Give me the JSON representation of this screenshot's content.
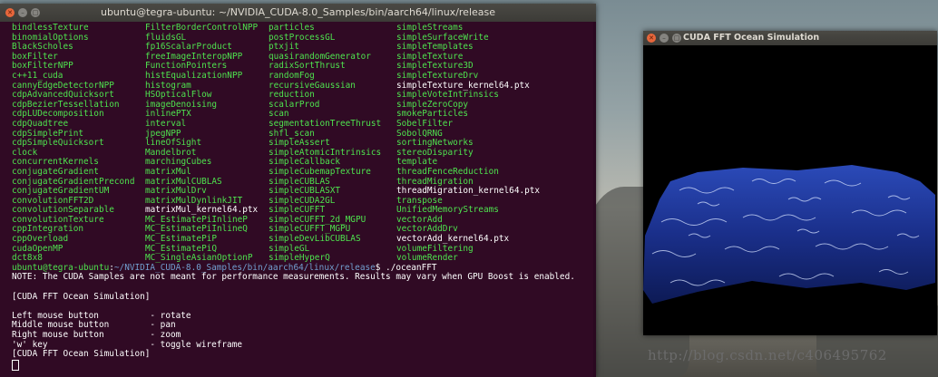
{
  "terminal": {
    "title": "ubuntu@tegra-ubuntu: ~/NVIDIA_CUDA-8.0_Samples/bin/aarch64/linux/release",
    "listing": [
      "bindlessTexture",
      "FilterBorderControlNPP",
      "particles",
      "simpleStreams",
      "binomialOptions",
      "fluidsGL",
      "postProcessGL",
      "simpleSurfaceWrite",
      "BlackScholes",
      "fp16ScalarProduct",
      "ptxjit",
      "simpleTemplates",
      "boxFilter",
      "freeImageInteropNPP",
      "quasirandomGenerator",
      "simpleTexture",
      "boxFilterNPP",
      "FunctionPointers",
      "radixSortThrust",
      "simpleTexture3D",
      "c++11_cuda",
      "histEqualizationNPP",
      "randomFog",
      "simpleTextureDrv",
      "cannyEdgeDetectorNPP",
      "histogram",
      "recursiveGaussian",
      "simpleTexture_kernel64.ptx",
      "cdpAdvancedQuicksort",
      "HSOpticalFlow",
      "reduction",
      "simpleVoteIntrinsics",
      "cdpBezierTessellation",
      "imageDenoising",
      "scalarProd",
      "simpleZeroCopy",
      "cdpLUDecomposition",
      "inlinePTX",
      "scan",
      "smokeParticles",
      "cdpQuadtree",
      "interval",
      "segmentationTreeThrust",
      "SobelFilter",
      "cdpSimplePrint",
      "jpegNPP",
      "shfl_scan",
      "SobolQRNG",
      "cdpSimpleQuicksort",
      "lineOfSight",
      "simpleAssert",
      "sortingNetworks",
      "clock",
      "Mandelbrot",
      "simpleAtomicIntrinsics",
      "stereoDisparity",
      "concurrentKernels",
      "marchingCubes",
      "simpleCallback",
      "template",
      "conjugateGradient",
      "matrixMul",
      "simpleCubemapTexture",
      "threadFenceReduction",
      "conjugateGradientPrecond",
      "matrixMulCUBLAS",
      "simpleCUBLAS",
      "threadMigration",
      "conjugateGradientUM",
      "matrixMulDrv",
      "simpleCUBLASXT",
      "threadMigration_kernel64.ptx",
      "convolutionFFT2D",
      "matrixMulDynlinkJIT",
      "simpleCUDA2GL",
      "transpose",
      "convolutionSeparable",
      "matrixMul_kernel64.ptx",
      "simpleCUFFT",
      "UnifiedMemoryStreams",
      "convolutionTexture",
      "MC_EstimatePiInlineP",
      "simpleCUFFT_2d_MGPU",
      "vectorAdd",
      "cppIntegration",
      "MC_EstimatePiInlineQ",
      "simpleCUFFT_MGPU",
      "vectorAddDrv",
      "cppOverload",
      "MC_EstimatePiP",
      "simpleDevLibCUBLAS",
      "vectorAdd_kernel64.ptx",
      "cudaOpenMP",
      "MC_EstimatePiQ",
      "simpleGL",
      "volumeFiltering",
      "dct8x8",
      "MC_SingleAsianOptionP",
      "simpleHyperQ",
      "volumeRender"
    ],
    "listing_white": [
      "simpleTexture_kernel64.ptx",
      "threadMigration_kernel64.ptx",
      "matrixMul_kernel64.ptx",
      "vectorAdd_kernel64.ptx"
    ],
    "prompt_user": "ubuntu@tegra-ubuntu",
    "prompt_sep": ":",
    "prompt_path": "~/NVIDIA_CUDA-8.0_Samples/bin/aarch64/linux/release",
    "prompt_cmd": "$ ./oceanFFT",
    "output_lines": [
      "NOTE: The CUDA Samples are not meant for performance measurements. Results may vary when GPU Boost is enabled.",
      "",
      "[CUDA FFT Ocean Simulation]",
      "",
      "Left mouse button          - rotate",
      "Middle mouse button        - pan",
      "Right mouse button         - zoom",
      "'w' key                    - toggle wireframe",
      "[CUDA FFT Ocean Simulation]"
    ]
  },
  "cuda_window": {
    "title": "CUDA FFT Ocean Simulation"
  },
  "watermark": "http://blog.csdn.net/c406495762",
  "colors": {
    "terminal_bg": "#300a24",
    "green": "#4ee34e",
    "blue": "#729fcf",
    "ocean": "#1a2f8a"
  }
}
